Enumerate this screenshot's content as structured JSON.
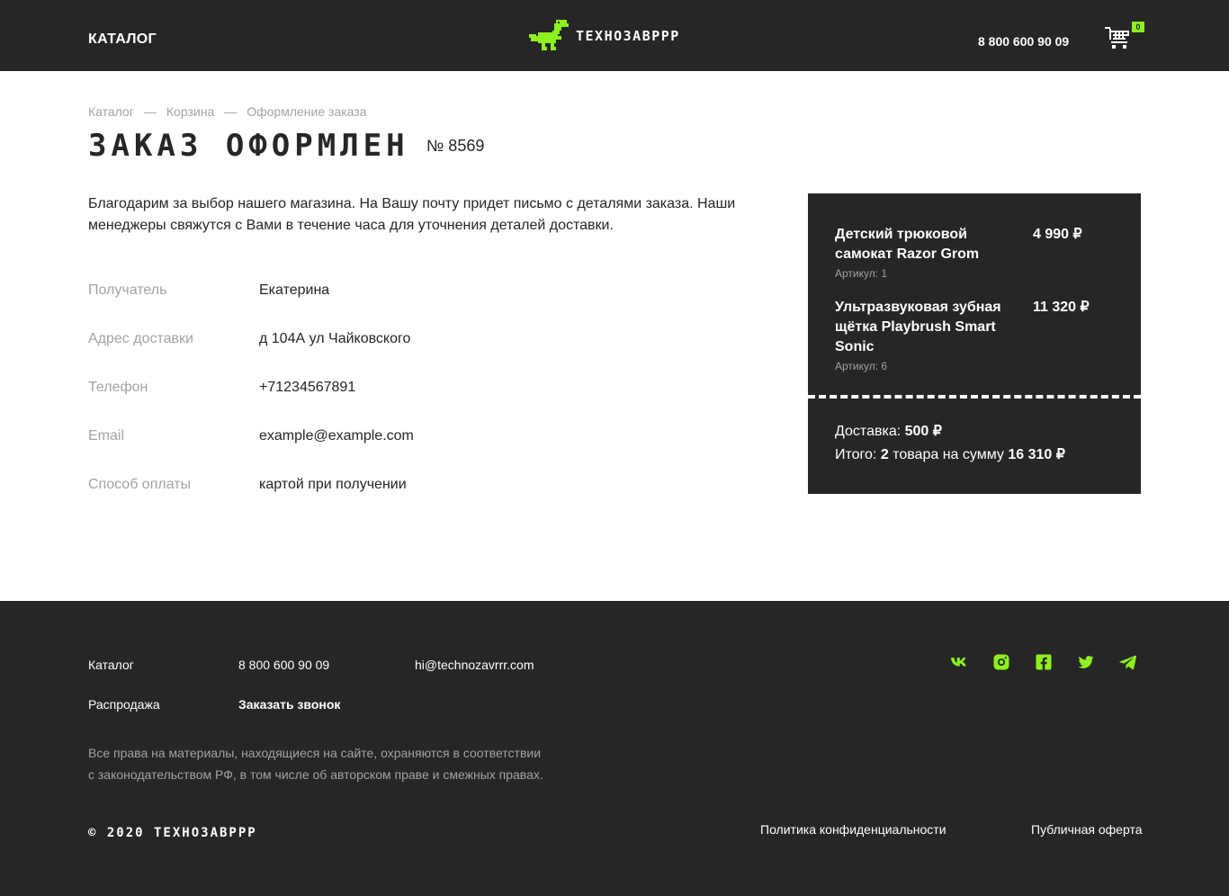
{
  "header": {
    "catalog_label": "КАТАЛОГ",
    "logo_text": "ТЕХНОЗАВРРР",
    "phone": "8 800 600 90 09",
    "cart_count": "0"
  },
  "breadcrumb": {
    "items": [
      "Каталог",
      "Корзина",
      "Оформление заказа"
    ],
    "separator": "—"
  },
  "main": {
    "title": "ЗАКАЗ ОФОРМЛЕН",
    "order_number": "№ 8569",
    "thanks_text": "Благодарим за выбор нашего магазина. На Вашу почту придет письмо с деталями заказа. Наши менеджеры свяжутся с Вами в течение часа для уточнения деталей доставки."
  },
  "details": [
    {
      "label": "Получатель",
      "value": "Екатерина"
    },
    {
      "label": "Адрес доставки",
      "value": "д 104А ул Чайковского"
    },
    {
      "label": "Телефон",
      "value": "+71234567891"
    },
    {
      "label": "Email",
      "value": "example@example.com"
    },
    {
      "label": "Способ оплаты",
      "value": "картой при получении"
    }
  ],
  "summary": {
    "items": [
      {
        "name": "Детский трюковой самокат Razor Grom",
        "price": "4 990 ₽",
        "article": "Артикул: 1"
      },
      {
        "name": "Ультразвуковая зубная щётка Playbrush Smart Sonic",
        "price": "11 320 ₽",
        "article": "Артикул: 6"
      }
    ],
    "delivery_label": "Доставка:",
    "delivery_value": "500 ₽",
    "total_prefix": "Итого:",
    "total_count": "2",
    "total_middle": "товара на сумму",
    "total_value": "16 310 ₽"
  },
  "footer": {
    "catalog": "Каталог",
    "sale": "Распродажа",
    "phone": "8 800 600 90 09",
    "callback": "Заказать звонок",
    "email": "hi@technozavrrr.com",
    "legal_line1": "Все права на материалы, находящиеся на сайте, охраняются в соответствии",
    "legal_line2": "с законодательством РФ, в том числе об авторском праве и смежных правах.",
    "copyright": "© 2020 ТЕХНОЗАВРРР",
    "privacy": "Политика конфиденциальности",
    "offer": "Публичная оферта",
    "socials": [
      "vk-icon",
      "instagram-icon",
      "facebook-icon",
      "twitter-icon",
      "telegram-icon"
    ]
  },
  "colors": {
    "dark": "#262626",
    "accent": "#8df01f",
    "muted": "#a3a3a3"
  }
}
